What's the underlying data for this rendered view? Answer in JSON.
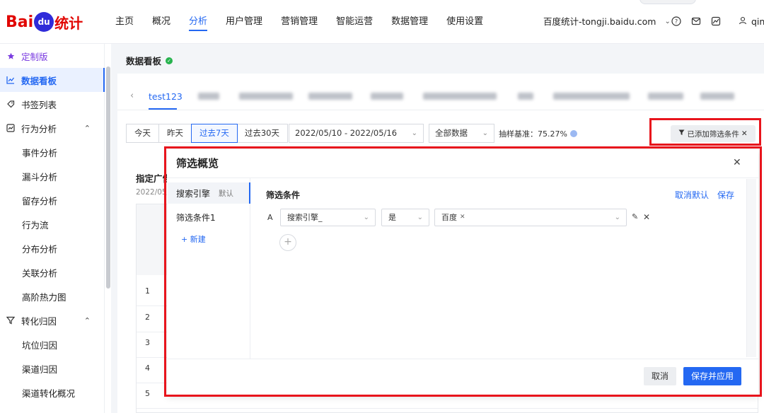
{
  "logo": {
    "text_left": "Bai",
    "text_paw": "du",
    "text_right": "统计"
  },
  "nav": {
    "items": [
      "主页",
      "概况",
      "分析",
      "用户管理",
      "营销管理",
      "智能运营",
      "数据管理",
      "使用设置"
    ],
    "active_index": 2
  },
  "site": {
    "name": "百度统计-tongji.baidu.com"
  },
  "user": {
    "name": "qin"
  },
  "sidebar": {
    "items": [
      {
        "label": "定制版",
        "icon": "star-icon"
      },
      {
        "label": "数据看板",
        "icon": "line-chart-icon",
        "active": true
      },
      {
        "label": "书签列表",
        "icon": "bookmark-icon"
      },
      {
        "label": "行为分析",
        "icon": "analysis-icon",
        "expandable": true
      },
      {
        "label": "事件分析",
        "sub": true
      },
      {
        "label": "漏斗分析",
        "sub": true
      },
      {
        "label": "留存分析",
        "sub": true
      },
      {
        "label": "行为流",
        "sub": true
      },
      {
        "label": "分布分析",
        "sub": true
      },
      {
        "label": "关联分析",
        "sub": true
      },
      {
        "label": "高阶热力图",
        "sub": true
      },
      {
        "label": "转化归因",
        "icon": "filter-funnel-icon",
        "expandable": true
      },
      {
        "label": "坑位归因",
        "sub": true
      },
      {
        "label": "渠道归因",
        "sub": true
      },
      {
        "label": "渠道转化概况",
        "sub": true
      }
    ]
  },
  "page": {
    "title": "数据看板"
  },
  "board_tabs": {
    "active_label": "test123"
  },
  "toolbar": {
    "date_buttons": [
      "今天",
      "昨天",
      "过去7天",
      "过去30天"
    ],
    "active_date_index": 2,
    "date_range": "2022/05/10 - 2022/05/16",
    "data_scope": "全部数据",
    "sampling_label": "抽样基准：75.27%",
    "filter_tag": "已添加筛选条件"
  },
  "section": {
    "title": "指定广告",
    "date": "2022/05/"
  },
  "table": {
    "row_numbers": [
      "1",
      "2",
      "3",
      "4",
      "5"
    ]
  },
  "dialog": {
    "title": "筛选概览",
    "left_items": [
      {
        "label": "搜索引擎",
        "default_label": "默认"
      },
      {
        "label": "筛选条件1"
      }
    ],
    "new_label": "+ 新建",
    "condition_title": "筛选条件",
    "cancel_default": "取消默认",
    "save": "保存",
    "row": {
      "letter": "A",
      "field": "搜索引擎_",
      "operator": "是",
      "value_chip": "百度"
    },
    "cancel_button": "取消",
    "save_apply_button": "保存并应用"
  }
}
